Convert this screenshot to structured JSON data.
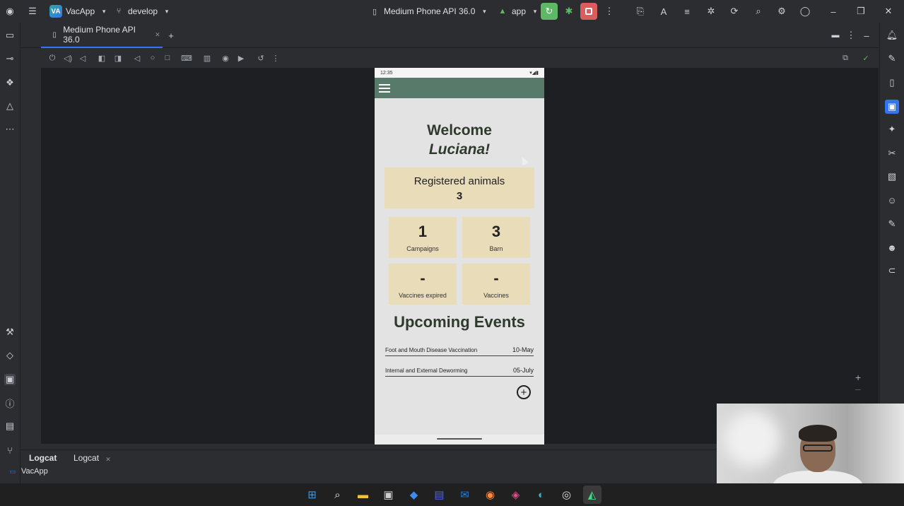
{
  "titlebar": {
    "project_badge": "VA",
    "project_name": "VacApp",
    "branch": "develop",
    "device": "Medium Phone API 36.0",
    "run_config": "app"
  },
  "tabs": [
    {
      "label": "Medium Phone API 36.0"
    }
  ],
  "phone": {
    "status_time": "12:35",
    "welcome_line1": "Welcome",
    "welcome_name": "Luciana!",
    "registered_label": "Registered animals",
    "registered_value": "3",
    "stats": [
      {
        "value": "1",
        "caption": "Campaigns"
      },
      {
        "value": "3",
        "caption": "Barn"
      },
      {
        "value": "-",
        "caption": "Vaccines expired"
      },
      {
        "value": "-",
        "caption": "Vaccines"
      }
    ],
    "upcoming_title": "Upcoming Events",
    "events": [
      {
        "name": "Foot and Mouth Disease Vaccination",
        "date": "10-May"
      },
      {
        "name": "Internal and External Deworming",
        "date": "05-July"
      }
    ]
  },
  "bottom": {
    "tabs": [
      "Logcat",
      "Logcat"
    ],
    "process": "VacApp"
  },
  "colors": {
    "appbar": "#587a6a",
    "card": "#e8dcb9",
    "title_text": "#2e3b2c",
    "accent": "#3574f0"
  }
}
